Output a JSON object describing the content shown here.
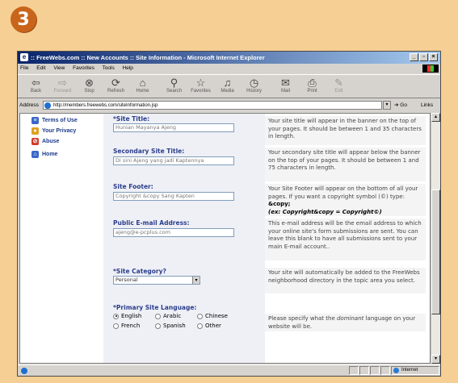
{
  "step": "3",
  "window": {
    "title": ":: FreeWebs.com :: New Accounts :: Site Information - Microsoft Internet Explorer",
    "controls": [
      "_",
      "▫",
      "×"
    ]
  },
  "menu": [
    "File",
    "Edit",
    "View",
    "Favorites",
    "Tools",
    "Help"
  ],
  "toolbar": [
    {
      "label": "Back",
      "icon": "back-arrow-icon",
      "glyph": "⇦"
    },
    {
      "label": "Forward",
      "icon": "forward-arrow-icon",
      "glyph": "⇨"
    },
    {
      "label": "Stop",
      "icon": "stop-icon",
      "glyph": "⊗"
    },
    {
      "label": "Refresh",
      "icon": "refresh-icon",
      "glyph": "⟳"
    },
    {
      "label": "Home",
      "icon": "home-icon",
      "glyph": "⌂"
    },
    {
      "label": "Search",
      "icon": "search-icon",
      "glyph": "⚲"
    },
    {
      "label": "Favorites",
      "icon": "favorites-icon",
      "glyph": "☆"
    },
    {
      "label": "Media",
      "icon": "media-icon",
      "glyph": "♫"
    },
    {
      "label": "History",
      "icon": "history-icon",
      "glyph": "◷"
    },
    {
      "label": "Mail",
      "icon": "mail-icon",
      "glyph": "✉"
    },
    {
      "label": "Print",
      "icon": "print-icon",
      "glyph": "⎙"
    },
    {
      "label": "Edit",
      "icon": "edit-icon",
      "glyph": "✎"
    }
  ],
  "address": {
    "label": "Address",
    "url": "http://members.freewebs.com/siteInformation.jsp",
    "go": "Go",
    "links": "Links"
  },
  "sidebar": [
    {
      "label": "Terms of Use",
      "color": "#3a66c8",
      "glyph": "≡"
    },
    {
      "label": "Your Privacy",
      "color": "#e0a020",
      "glyph": "●"
    },
    {
      "label": "Abuse",
      "color": "#d33a2a",
      "glyph": "⊘"
    },
    {
      "label": "Home",
      "color": "#3a66c8",
      "glyph": "⌂"
    }
  ],
  "form": {
    "site_title": {
      "label": "*Site Title:",
      "value": "Hunian Mayanya Ajeng"
    },
    "secondary_title": {
      "label": "Secondary Site Title:",
      "value": "Di sini Ajeng yang jadi Kaptennya"
    },
    "footer": {
      "label": "Site Footer:",
      "value": "Copyright &copy Sang Kapten"
    },
    "email": {
      "label": "Public E-mail Address:",
      "value": "ajeng@e-pcplus.com"
    },
    "category": {
      "label": "*Site Category?",
      "value": "Personal"
    },
    "language": {
      "label": "*Primary Site Language:",
      "options": [
        "English",
        "Arabic",
        "Chinese",
        "French",
        "Spanish",
        "Other"
      ],
      "selected": "English"
    }
  },
  "help": {
    "site_title": "Your site title will appear in the banner on the top of your pages. It should be between 1 and 35 characters in length.",
    "secondary_title": "Your secondary site title will appear below the banner on the top of your pages. It should be between 1 and 75 characters in length.",
    "footer_a": "Your Site Footer will appear on the bottom of all your pages. If you want a copyright symbol (©) type: ",
    "footer_b": "&copy;",
    "footer_c": "(ex: Copyright&copy = Copyright©)",
    "email": "This e-mail address will be the email address to which your online site's form submissions are sent. You can leave this blank to have all submissions sent to your main E-mail account..",
    "category": "Your site will automatically be added to the FreeWebs neighborhood directory in the topic area you select.",
    "language_a": "Please specify what the ",
    "language_b": "dominant",
    "language_c": " language on your website will be."
  },
  "status": {
    "zone": "Internet"
  }
}
